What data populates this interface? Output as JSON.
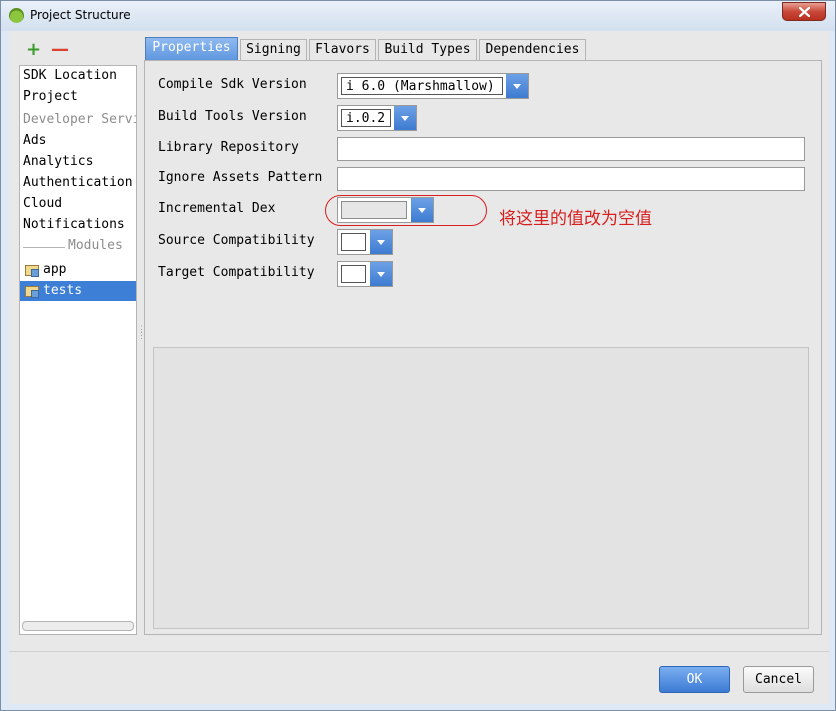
{
  "window": {
    "title": "Project Structure"
  },
  "toolbar": {
    "add_label": "+",
    "remove_label": "—"
  },
  "sidebar": {
    "items": [
      {
        "label": "SDK Location"
      },
      {
        "label": "Project"
      },
      {
        "label": "Developer Servi"
      },
      {
        "label": "Ads"
      },
      {
        "label": "Analytics"
      },
      {
        "label": "Authentication"
      },
      {
        "label": "Cloud"
      },
      {
        "label": "Notifications"
      }
    ],
    "modules_header": "Modules",
    "modules": [
      {
        "label": "app"
      },
      {
        "label": "tests",
        "selected": true
      }
    ]
  },
  "tabs": [
    {
      "label": "Properties",
      "active": true
    },
    {
      "label": "Signing"
    },
    {
      "label": "Flavors"
    },
    {
      "label": "Build Types"
    },
    {
      "label": "Dependencies"
    }
  ],
  "form": {
    "compile_sdk": {
      "label": "Compile Sdk Version",
      "value": "i 6.0 (Marshmallow)"
    },
    "build_tools": {
      "label": "Build Tools Version",
      "value": "i.0.2"
    },
    "library_repo": {
      "label": "Library Repository",
      "value": ""
    },
    "ignore_assets": {
      "label": "Ignore Assets Pattern",
      "value": ""
    },
    "incremental_dex": {
      "label": "Incremental Dex",
      "value": ""
    },
    "source_compat": {
      "label": "Source Compatibility",
      "value": ""
    },
    "target_compat": {
      "label": "Target Compatibility",
      "value": ""
    }
  },
  "annotation": {
    "text": "将这里的值改为空值",
    "color": "#d81e1e"
  },
  "buttons": {
    "ok": "OK",
    "cancel": "Cancel"
  },
  "colors": {
    "accent": "#3d7fd6",
    "annotation": "#d81e1e"
  }
}
